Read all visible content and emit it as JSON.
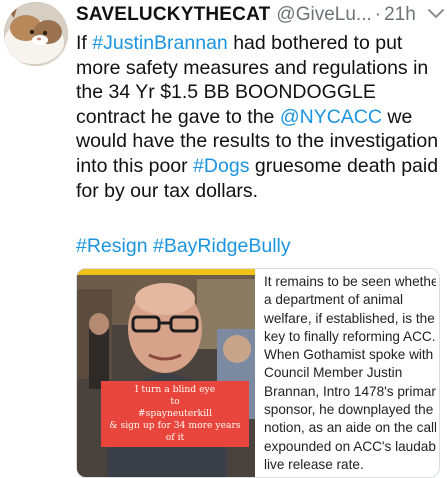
{
  "tweet": {
    "display_name": "SAVELUCKYTHECAT",
    "handle": "@GiveLu...",
    "separator": "·",
    "timestamp": "21h",
    "body_parts": [
      {
        "text": "If ",
        "link": false
      },
      {
        "text": "#JustinBrannan",
        "link": true
      },
      {
        "text": " had bothered to put more safety measures and regulations in the 34 Yr $1.5 BB BOONDOGGLE contract he gave to the ",
        "link": false
      },
      {
        "text": "@NYCACC",
        "link": true
      },
      {
        "text": " we would have the results to the investigation into this poor ",
        "link": false
      },
      {
        "text": "#Dogs",
        "link": true
      },
      {
        "text": " gruesome death paid for by our  tax dollars.",
        "link": false
      }
    ],
    "hashtags": [
      "#Resign",
      "#BayRidgeBully"
    ]
  },
  "card": {
    "image_caption_lines": [
      "I turn a blind eye",
      "to",
      "#spayneuterkill",
      "& sign up for 34 more years",
      "of it"
    ],
    "article_lines": [
      "It remains to be seen whethe",
      "a department of animal",
      "welfare, if established, is the",
      "key to finally reforming ACC.",
      "When Gothamist spoke with",
      "Council Member Justin",
      "Brannan, Intro 1478's primar",
      "sponsor, he downplayed the",
      "notion, as an aide on the call",
      "expounded on ACC's laudab",
      "live release rate."
    ]
  },
  "colors": {
    "link": "#1b95e0",
    "meta": "#6e7378",
    "caption_bg": "#e8453c"
  },
  "icons": {
    "avatar": "cat-photo-avatar",
    "more": "chevron-down-icon"
  }
}
